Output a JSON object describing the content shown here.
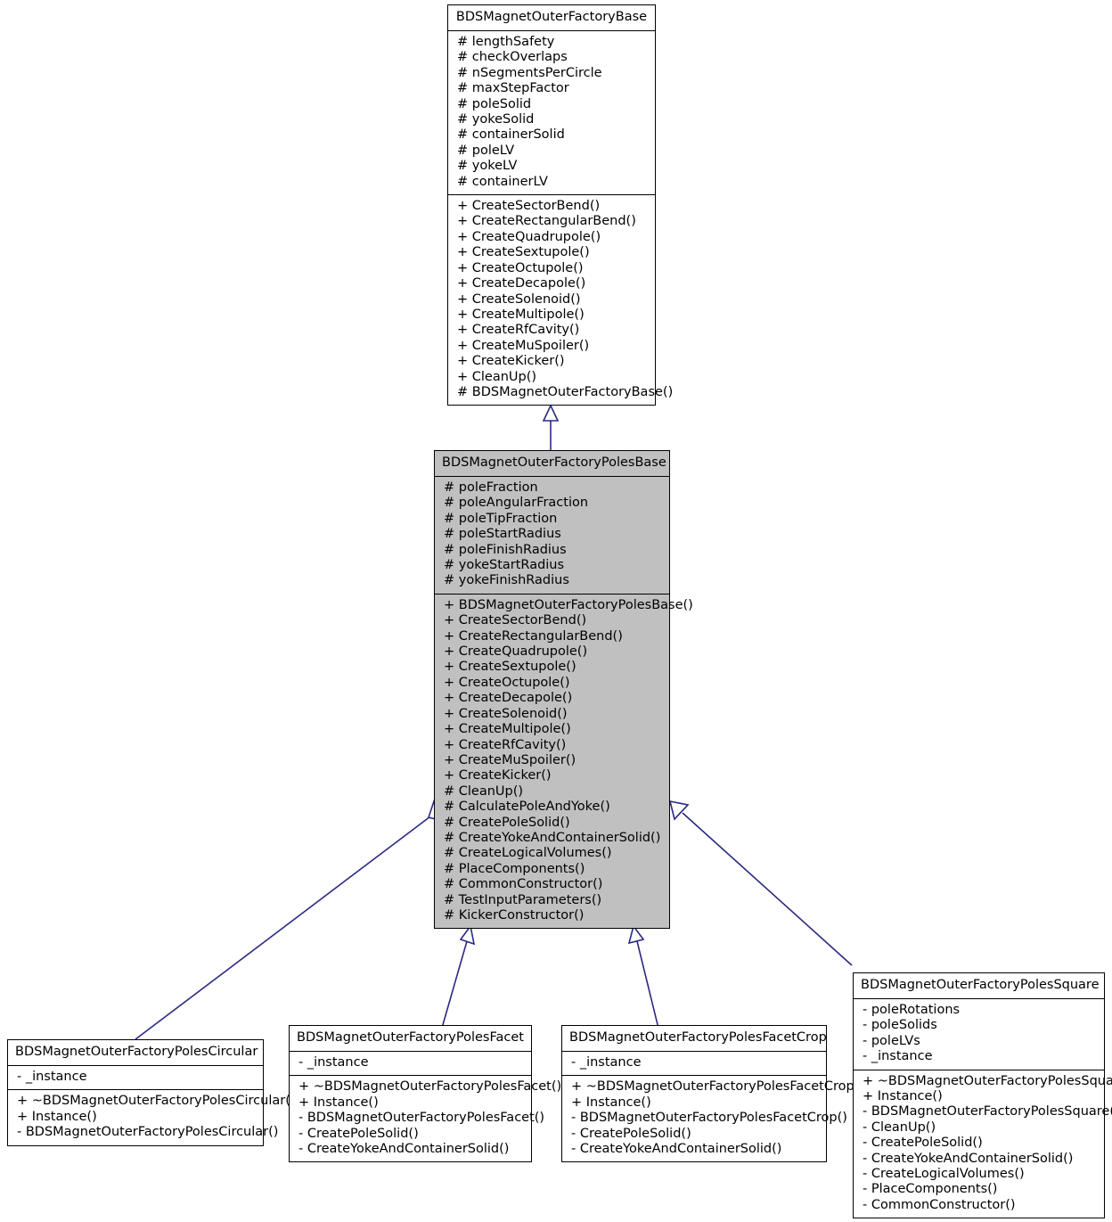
{
  "diagram": {
    "type": "uml-class-inheritance",
    "title_visible": false,
    "edge_color": "#2a2a82",
    "highlight_fill": "#c0c0c0",
    "box_fill": "#ffffff",
    "border_color": "#000000"
  },
  "classes": {
    "base": {
      "name": "BDSMagnetOuterFactoryBase",
      "attributes": [
        "# lengthSafety",
        "# checkOverlaps",
        "# nSegmentsPerCircle",
        "# maxStepFactor",
        "# poleSolid",
        "# yokeSolid",
        "# containerSolid",
        "# poleLV",
        "# yokeLV",
        "# containerLV"
      ],
      "methods": [
        "+ CreateSectorBend()",
        "+ CreateRectangularBend()",
        "+ CreateQuadrupole()",
        "+ CreateSextupole()",
        "+ CreateOctupole()",
        "+ CreateDecapole()",
        "+ CreateSolenoid()",
        "+ CreateMultipole()",
        "+ CreateRfCavity()",
        "+ CreateMuSpoiler()",
        "+ CreateKicker()",
        "+ CleanUp()",
        "# BDSMagnetOuterFactoryBase()"
      ]
    },
    "polesBase": {
      "name": "BDSMagnetOuterFactoryPolesBase",
      "attributes": [
        "# poleFraction",
        "# poleAngularFraction",
        "# poleTipFraction",
        "# poleStartRadius",
        "# poleFinishRadius",
        "# yokeStartRadius",
        "# yokeFinishRadius"
      ],
      "methods": [
        "+ BDSMagnetOuterFactoryPolesBase()",
        "+ CreateSectorBend()",
        "+ CreateRectangularBend()",
        "+ CreateQuadrupole()",
        "+ CreateSextupole()",
        "+ CreateOctupole()",
        "+ CreateDecapole()",
        "+ CreateSolenoid()",
        "+ CreateMultipole()",
        "+ CreateRfCavity()",
        "+ CreateMuSpoiler()",
        "+ CreateKicker()",
        "# CleanUp()",
        "# CalculatePoleAndYoke()",
        "# CreatePoleSolid()",
        "# CreateYokeAndContainerSolid()",
        "# CreateLogicalVolumes()",
        "# PlaceComponents()",
        "# CommonConstructor()",
        "# TestInputParameters()",
        "# KickerConstructor()"
      ]
    },
    "polesCircular": {
      "name": "BDSMagnetOuterFactoryPolesCircular",
      "attributes": [
        "- _instance"
      ],
      "methods": [
        "+ ~BDSMagnetOuterFactoryPolesCircular()",
        "+ Instance()",
        "- BDSMagnetOuterFactoryPolesCircular()"
      ]
    },
    "polesFacet": {
      "name": "BDSMagnetOuterFactoryPolesFacet",
      "attributes": [
        "- _instance"
      ],
      "methods": [
        "+ ~BDSMagnetOuterFactoryPolesFacet()",
        "+ Instance()",
        "- BDSMagnetOuterFactoryPolesFacet()",
        "- CreatePoleSolid()",
        "- CreateYokeAndContainerSolid()"
      ]
    },
    "polesFacetCrop": {
      "name": "BDSMagnetOuterFactoryPolesFacetCrop",
      "attributes": [
        "- _instance"
      ],
      "methods": [
        "+ ~BDSMagnetOuterFactoryPolesFacetCrop()",
        "+ Instance()",
        "- BDSMagnetOuterFactoryPolesFacetCrop()",
        "- CreatePoleSolid()",
        "- CreateYokeAndContainerSolid()"
      ]
    },
    "polesSquare": {
      "name": "BDSMagnetOuterFactoryPolesSquare",
      "attributes": [
        "- poleRotations",
        "- poleSolids",
        "- poleLVs",
        "- _instance"
      ],
      "methods": [
        "+ ~BDSMagnetOuterFactoryPolesSquare()",
        "+ Instance()",
        "- BDSMagnetOuterFactoryPolesSquare()",
        "- CleanUp()",
        "- CreatePoleSolid()",
        "- CreateYokeAndContainerSolid()",
        "- CreateLogicalVolumes()",
        "- PlaceComponents()",
        "- CommonConstructor()"
      ]
    }
  },
  "inheritance": [
    {
      "from": "BDSMagnetOuterFactoryPolesBase",
      "to": "BDSMagnetOuterFactoryBase"
    },
    {
      "from": "BDSMagnetOuterFactoryPolesCircular",
      "to": "BDSMagnetOuterFactoryPolesBase"
    },
    {
      "from": "BDSMagnetOuterFactoryPolesFacet",
      "to": "BDSMagnetOuterFactoryPolesBase"
    },
    {
      "from": "BDSMagnetOuterFactoryPolesFacetCrop",
      "to": "BDSMagnetOuterFactoryPolesBase"
    },
    {
      "from": "BDSMagnetOuterFactoryPolesSquare",
      "to": "BDSMagnetOuterFactoryPolesBase"
    }
  ]
}
